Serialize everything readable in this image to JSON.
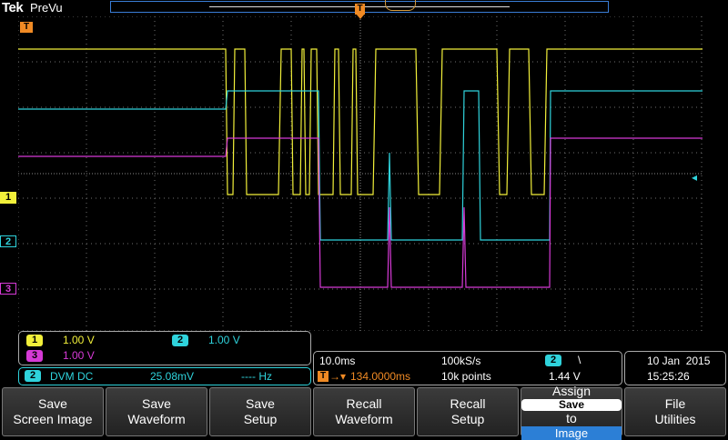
{
  "topbar": {
    "brand": "Tek",
    "status": "PreVu"
  },
  "colors": {
    "ch1": "#f2f03a",
    "ch2": "#2fd3dc",
    "ch3": "#d63ad6",
    "trigger": "#f08a24",
    "grid": "#6f6f6f",
    "accent": "#2c7fd6"
  },
  "markers": {
    "trigger_top": "T",
    "trigger_left": "T",
    "ch1": "1",
    "ch2": "2",
    "ch3": "3"
  },
  "channels_panel": {
    "ch1": {
      "num": "1",
      "scale": "1.00 V"
    },
    "ch2": {
      "num": "2",
      "scale": "1.00 V"
    },
    "ch3": {
      "num": "3",
      "scale": "1.00 V"
    }
  },
  "dvm": {
    "num": "2",
    "mode": "DVM DC",
    "value": "25.08mV",
    "freq": "---- Hz"
  },
  "timebase": {
    "time_div": "10.0ms",
    "sample_rate": "100kS/s",
    "trig_pos_icon": "T",
    "trig_pos": "134.0000ms",
    "record": "10k points",
    "trig_ch": "2",
    "trig_slope": "\\",
    "trig_level": "1.44 V"
  },
  "datetime": {
    "date": "10 Jan  2015",
    "time": "15:25:26"
  },
  "menu": [
    {
      "line1": "Save",
      "line2": "Screen Image"
    },
    {
      "line1": "Save",
      "line2": "Waveform"
    },
    {
      "line1": "Save",
      "line2": "Setup"
    },
    {
      "line1": "Recall",
      "line2": "Waveform"
    },
    {
      "line1": "Recall",
      "line2": "Setup"
    },
    {
      "line1": "Assign",
      "save": "Save",
      "to": "to",
      "target": "Image"
    },
    {
      "line1": "File",
      "line2": "Utilities"
    }
  ]
}
